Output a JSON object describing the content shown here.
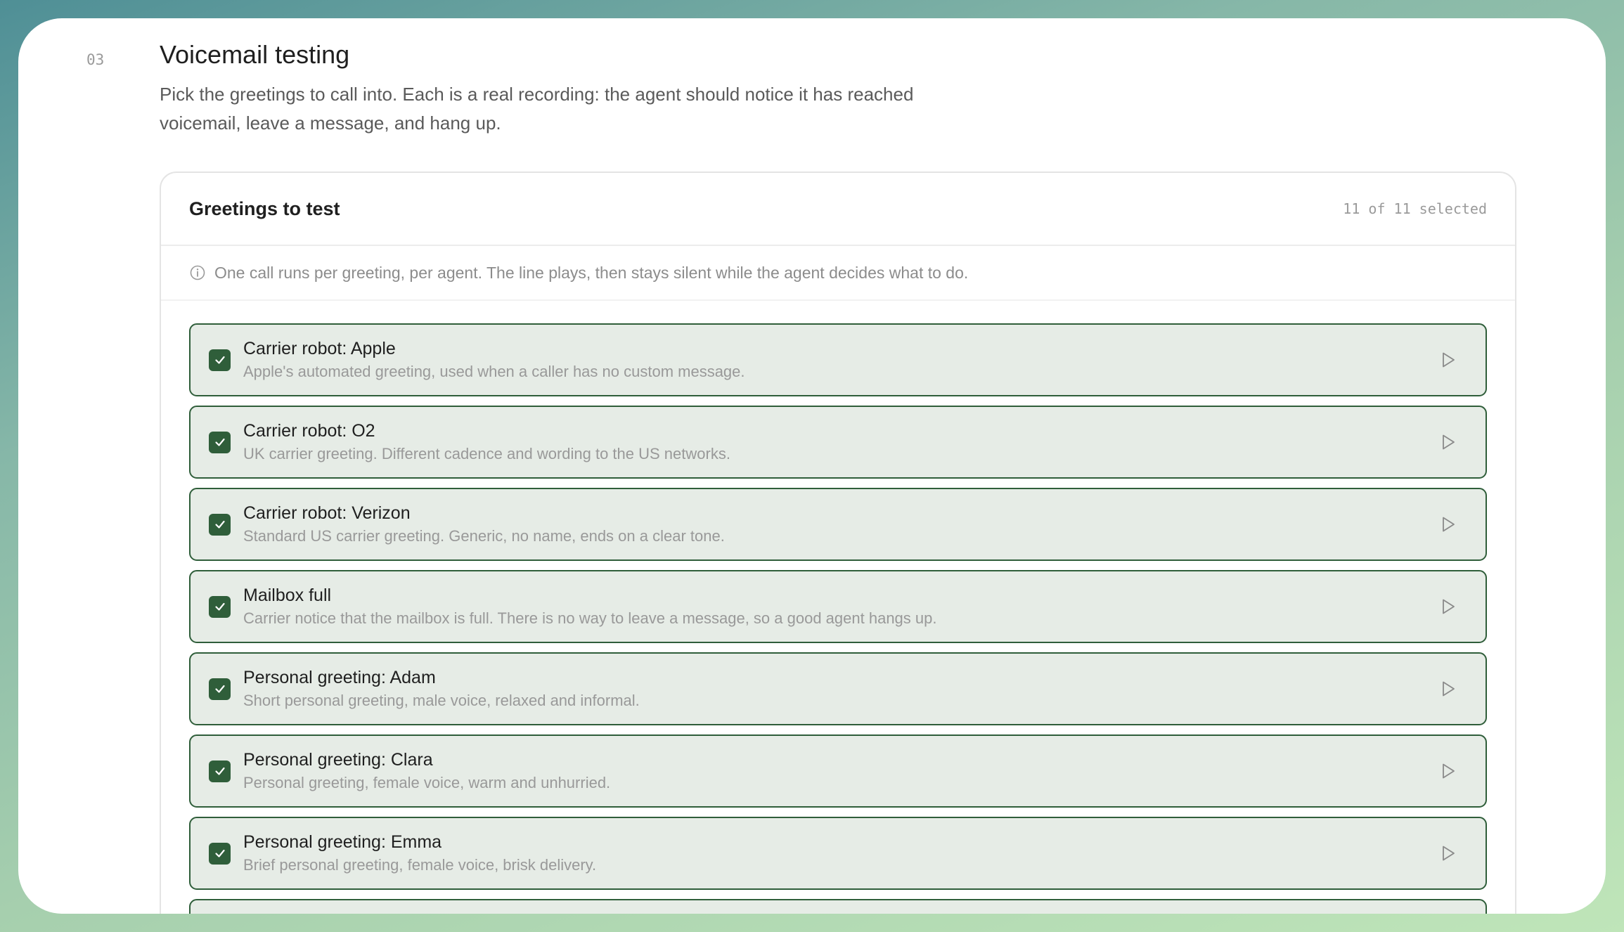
{
  "section": {
    "number": "03",
    "title": "Voicemail testing",
    "description": "Pick the greetings to call into. Each is a real recording: the agent should notice it has reached voicemail, leave a message, and hang up."
  },
  "panel": {
    "title": "Greetings to test",
    "count": "11 of 11 selected",
    "info": "One call runs per greeting, per agent. The line plays, then stays silent while the agent decides what to do."
  },
  "greetings": [
    {
      "title": "Carrier robot: Apple",
      "description": "Apple's automated greeting, used when a caller has no custom message."
    },
    {
      "title": "Carrier robot: O2",
      "description": "UK carrier greeting. Different cadence and wording to the US networks."
    },
    {
      "title": "Carrier robot: Verizon",
      "description": "Standard US carrier greeting. Generic, no name, ends on a clear tone."
    },
    {
      "title": "Mailbox full",
      "description": "Carrier notice that the mailbox is full. There is no way to leave a message, so a good agent hangs up."
    },
    {
      "title": "Personal greeting: Adam",
      "description": "Short personal greeting, male voice, relaxed and informal."
    },
    {
      "title": "Personal greeting: Clara",
      "description": "Personal greeting, female voice, warm and unhurried."
    },
    {
      "title": "Personal greeting: Emma",
      "description": "Brief personal greeting, female voice, brisk delivery."
    }
  ],
  "colors": {
    "accent": "#2f5e3a",
    "selected_bg": "#e6ece6"
  },
  "icons": {
    "checkbox": "check-icon",
    "play": "play-icon",
    "info": "info-icon"
  }
}
